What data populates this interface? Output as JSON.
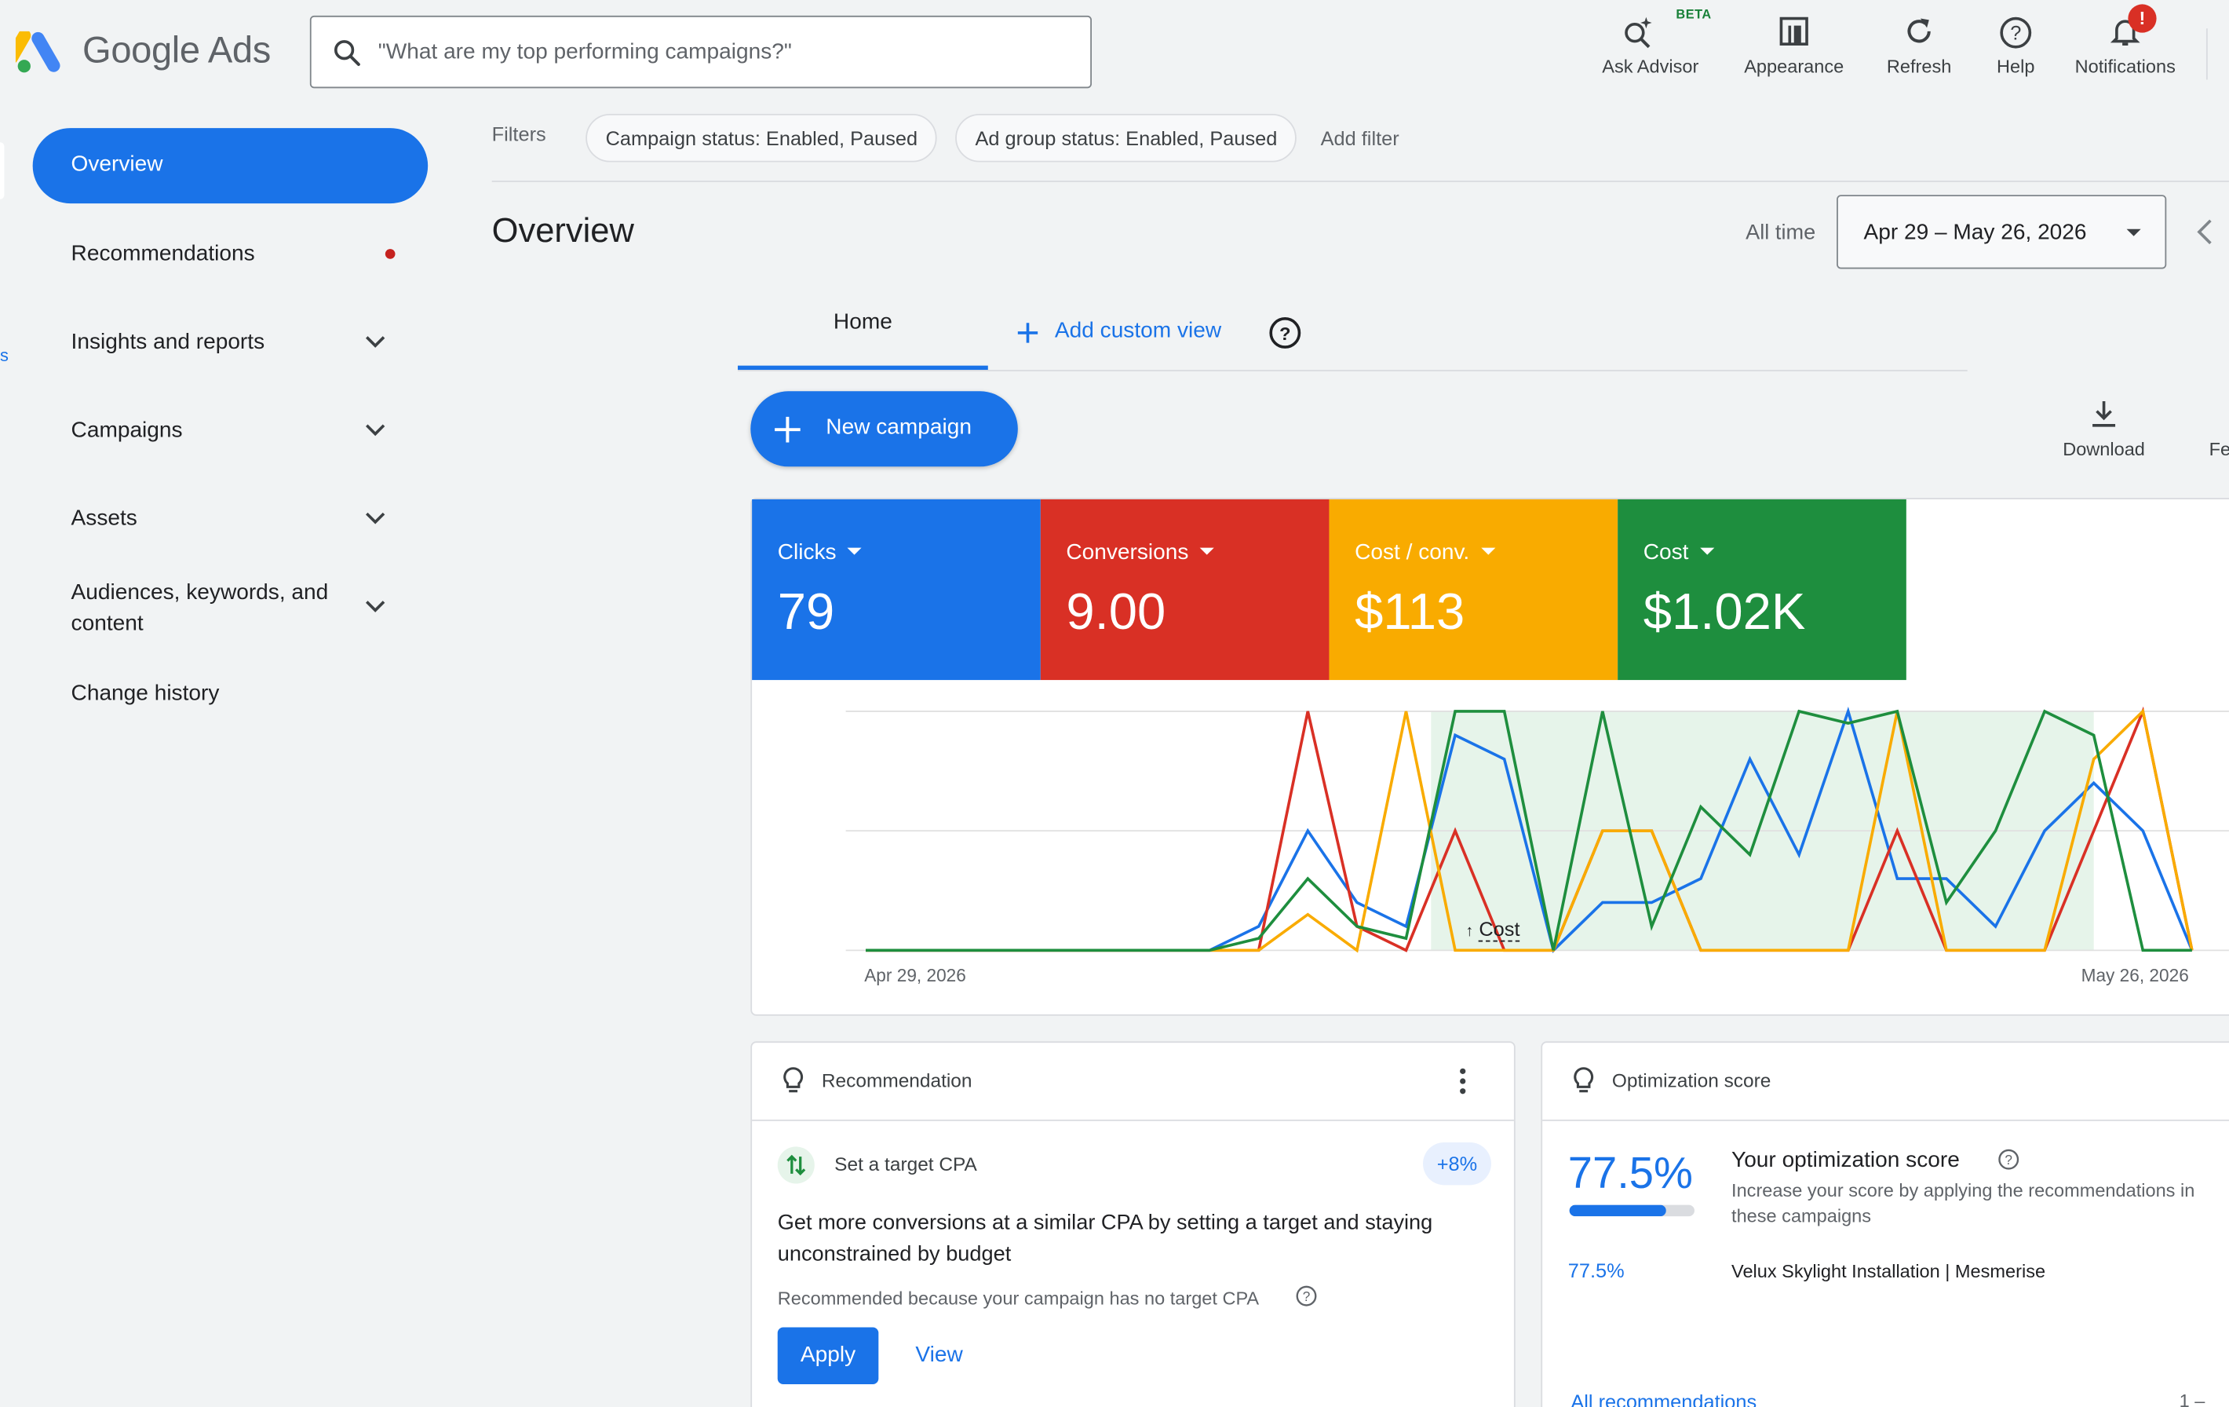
{
  "app": {
    "name": "Google Ads",
    "logo_colors": [
      "#fbbc04",
      "#4285f4",
      "#34a853"
    ]
  },
  "header": {
    "search_placeholder": "\"What are my top performing campaigns?\"",
    "buttons": [
      {
        "label": "Ask Advisor",
        "icon": "ask-advisor-icon",
        "badge": "BETA"
      },
      {
        "label": "Appearance",
        "icon": "appearance-icon"
      },
      {
        "label": "Refresh",
        "icon": "refresh-icon"
      },
      {
        "label": "Help",
        "icon": "help-icon"
      },
      {
        "label": "Notifications",
        "icon": "bell-icon",
        "badge": "!"
      }
    ]
  },
  "sidebar": {
    "items": [
      {
        "label": "Overview",
        "active": true
      },
      {
        "label": "Recommendations",
        "dot": true
      },
      {
        "label": "Insights and reports",
        "expandable": true
      },
      {
        "label": "Campaigns",
        "expandable": true
      },
      {
        "label": "Assets",
        "expandable": true
      },
      {
        "label": "Audiences, keywords, and content",
        "expandable": true
      },
      {
        "label": "Change history"
      }
    ],
    "edge_text": "s"
  },
  "filters": {
    "label": "Filters",
    "chips": [
      "Campaign status: Enabled, Paused",
      "Ad group status: Enabled, Paused"
    ],
    "add": "Add filter"
  },
  "page": {
    "title": "Overview",
    "date_range_label": "All time",
    "date_range": "Apr 29 – May 26, 2026",
    "tabs": {
      "home": "Home",
      "add_view": "Add custom view"
    },
    "new_campaign": "New campaign",
    "download": "Download",
    "truncated_action": "Fe"
  },
  "metrics": [
    {
      "label": "Clicks",
      "value": "79",
      "color": "#1a73e8"
    },
    {
      "label": "Conversions",
      "value": "9.00",
      "color": "#d93025"
    },
    {
      "label": "Cost / conv.",
      "value": "$113",
      "color": "#f9ab00"
    },
    {
      "label": "Cost",
      "value": "$1.02K",
      "color": "#1e8e3e"
    }
  ],
  "chart_data": {
    "type": "line",
    "x_start_label": "Apr 29, 2026",
    "x_end_label": "May 26, 2026",
    "annotation": "Cost",
    "highlight_range": [
      12,
      25
    ],
    "y_scale": "normalized 0–1 per series (no y-axis labels printed)",
    "x": [
      0,
      1,
      2,
      3,
      4,
      5,
      6,
      7,
      8,
      9,
      10,
      11,
      12,
      13,
      14,
      15,
      16,
      17,
      18,
      19,
      20,
      21,
      22,
      23,
      24,
      25,
      26,
      27
    ],
    "series": [
      {
        "name": "Clicks",
        "color": "#1a73e8",
        "values": [
          0,
          0,
          0,
          0,
          0,
          0,
          0,
          0,
          0.1,
          0.5,
          0.2,
          0.1,
          0.9,
          0.8,
          0,
          0.2,
          0.2,
          0.3,
          0.8,
          0.4,
          1,
          0.3,
          0.3,
          0.1,
          0.5,
          0.7,
          0.5,
          0
        ]
      },
      {
        "name": "Conversions",
        "color": "#d93025",
        "values": [
          0,
          0,
          0,
          0,
          0,
          0,
          0,
          0,
          0,
          1,
          0.1,
          0,
          0.5,
          0,
          0,
          0.5,
          0.5,
          0,
          0,
          0,
          0,
          0.5,
          0,
          0,
          0,
          0.5,
          1,
          0
        ]
      },
      {
        "name": "Cost / conv.",
        "color": "#f9ab00",
        "values": [
          0,
          0,
          0,
          0,
          0,
          0,
          0,
          0,
          0,
          0.15,
          0,
          1,
          0,
          0,
          0,
          0.5,
          0.5,
          0,
          0,
          0,
          0,
          1,
          0,
          0,
          0,
          0.8,
          1,
          0
        ]
      },
      {
        "name": "Cost",
        "color": "#1e8e3e",
        "values": [
          0,
          0,
          0,
          0,
          0,
          0,
          0,
          0,
          0.05,
          0.3,
          0.1,
          0.05,
          1,
          1,
          0,
          1,
          0.1,
          0.6,
          0.4,
          1,
          0.95,
          1,
          0.2,
          0.5,
          1,
          0.9,
          0,
          0
        ]
      }
    ]
  },
  "recommendation_card": {
    "header": "Recommendation",
    "title": "Set a target CPA",
    "badge": "+8%",
    "body": "Get more conversions at a similar CPA by setting a target and staying unconstrained by budget",
    "note": "Recommended because your campaign has no target CPA",
    "apply": "Apply",
    "view": "View"
  },
  "optimization_card": {
    "header": "Optimization score",
    "score": "77.5%",
    "score_value": 0.775,
    "title": "Your optimization score",
    "desc": "Increase your score by applying the recommendations in these campaigns",
    "row_score": "77.5%",
    "row_campaign": "Velux Skylight Installation | Mesmerise",
    "link": "All recommendations",
    "pager": "1 –"
  }
}
